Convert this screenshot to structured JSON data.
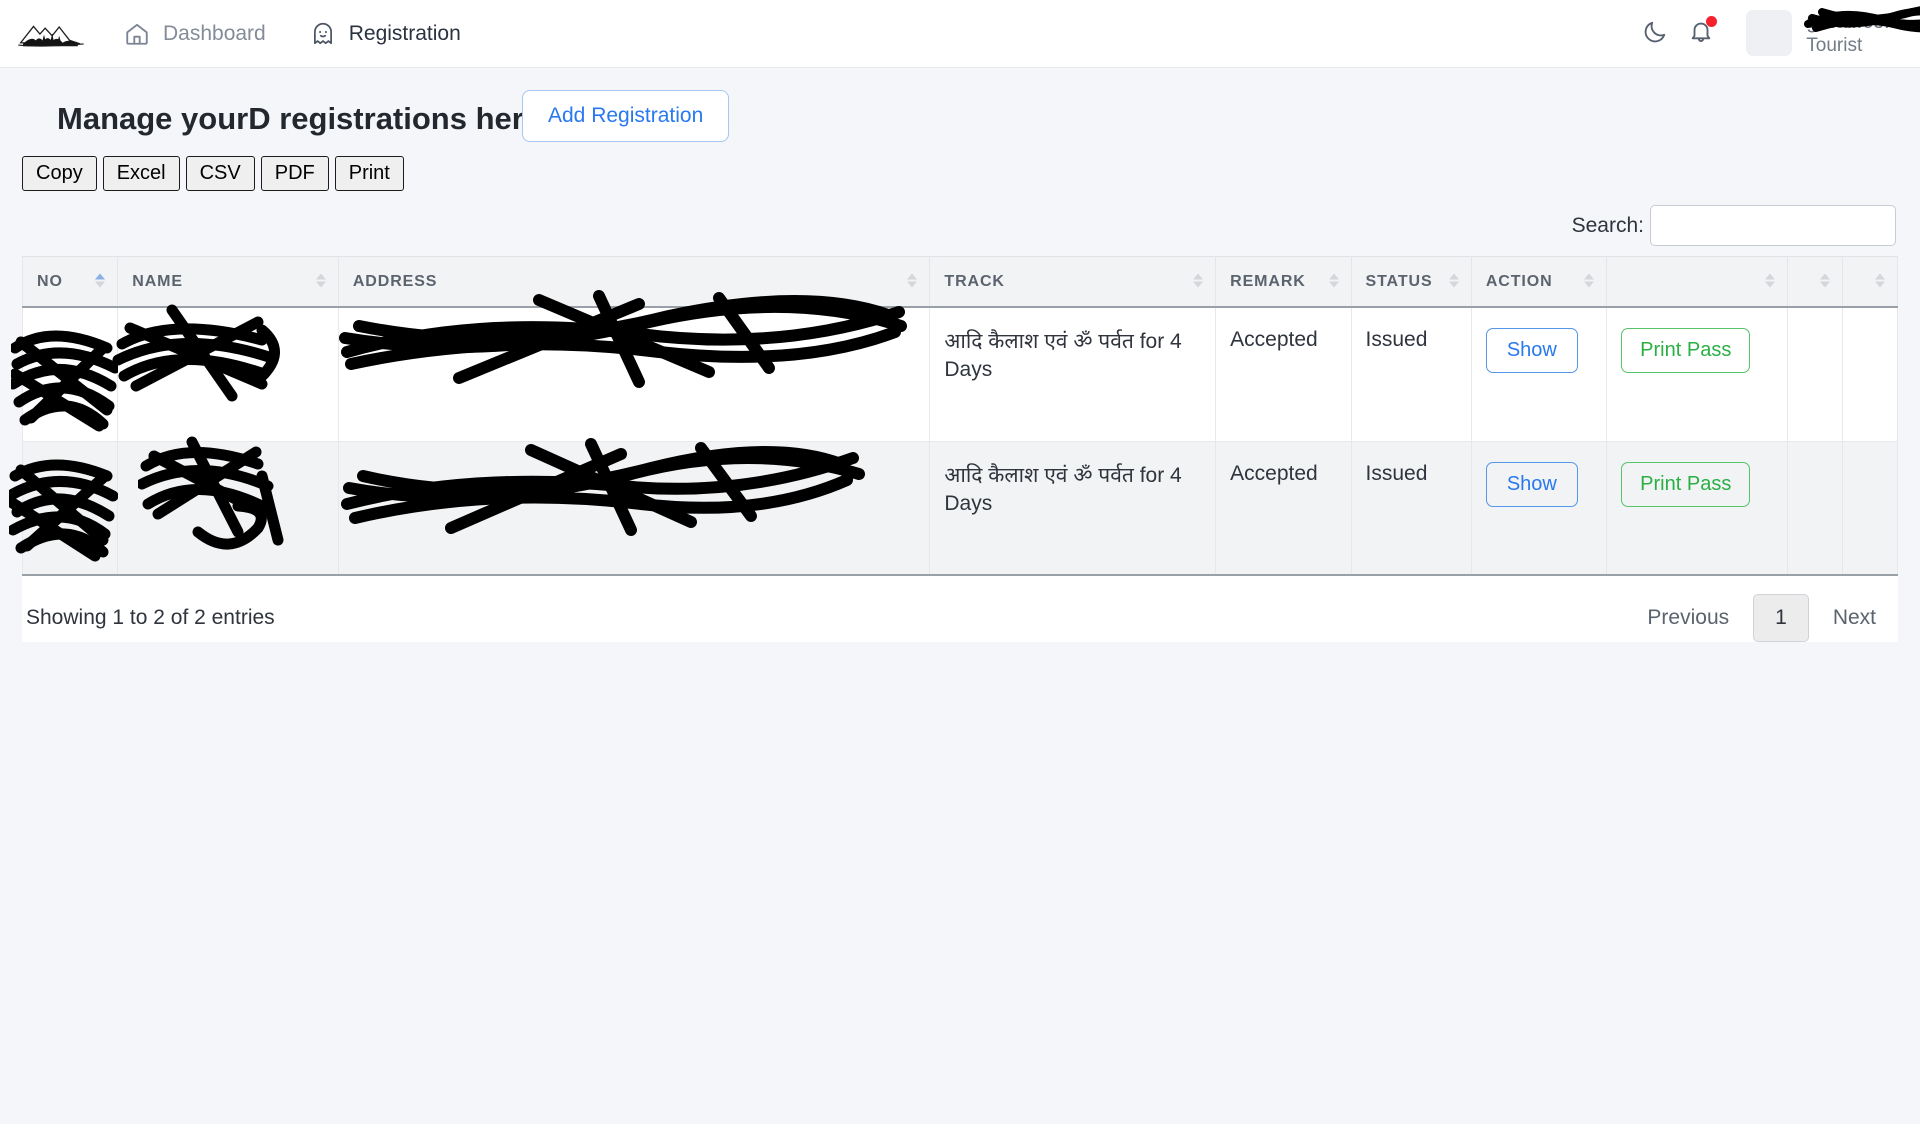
{
  "navbar": {
    "logo_alt": "mountain-logo",
    "links": [
      {
        "label": "Dashboard",
        "icon": "home-icon"
      },
      {
        "label": "Registration",
        "icon": "ghost-icon"
      }
    ],
    "dark_mode_icon": "moon-icon",
    "notification_icon": "bell-icon",
    "user": {
      "email": "gmail.com",
      "role": "Tourist"
    }
  },
  "page": {
    "title": "Manage yourD registrations here",
    "add_button": "Add Registration"
  },
  "export_buttons": [
    {
      "label": "Copy"
    },
    {
      "label": "Excel"
    },
    {
      "label": "CSV"
    },
    {
      "label": "PDF"
    },
    {
      "label": "Print"
    }
  ],
  "search": {
    "label": "Search:",
    "value": "",
    "placeholder": ""
  },
  "table": {
    "columns": [
      {
        "label": "NO",
        "sort": "asc"
      },
      {
        "label": "NAME",
        "sort": "none"
      },
      {
        "label": "ADDRESS",
        "sort": "none"
      },
      {
        "label": "TRACK",
        "sort": "none"
      },
      {
        "label": "REMARK",
        "sort": "none"
      },
      {
        "label": "STATUS",
        "sort": "none"
      },
      {
        "label": "ACTION",
        "sort": "none"
      },
      {
        "label": "",
        "sort": "none"
      },
      {
        "label": "",
        "sort": "none"
      },
      {
        "label": "",
        "sort": "none"
      }
    ],
    "rows": [
      {
        "no": "",
        "name": "",
        "address": "",
        "track": "आदि कैलाश एवं ॐ पर्वत for 4 Days",
        "remark": "Accepted",
        "status": "Issued",
        "show_label": "Show",
        "print_label": "Print Pass"
      },
      {
        "no": "",
        "name": "",
        "address": "",
        "track": "आदि कैलाश एवं ॐ पर्वत for 4 Days",
        "remark": "Accepted",
        "status": "Issued",
        "show_label": "Show",
        "print_label": "Print Pass"
      }
    ]
  },
  "footer": {
    "entries_info": "Showing 1 to 2 of 2 entries",
    "previous": "Previous",
    "current_page": "1",
    "next": "Next"
  },
  "colors": {
    "accent_blue": "#2879f0",
    "accent_green": "#2aaf45",
    "page_bg": "#f4f6f9",
    "notification_dot": "#f5222d"
  }
}
